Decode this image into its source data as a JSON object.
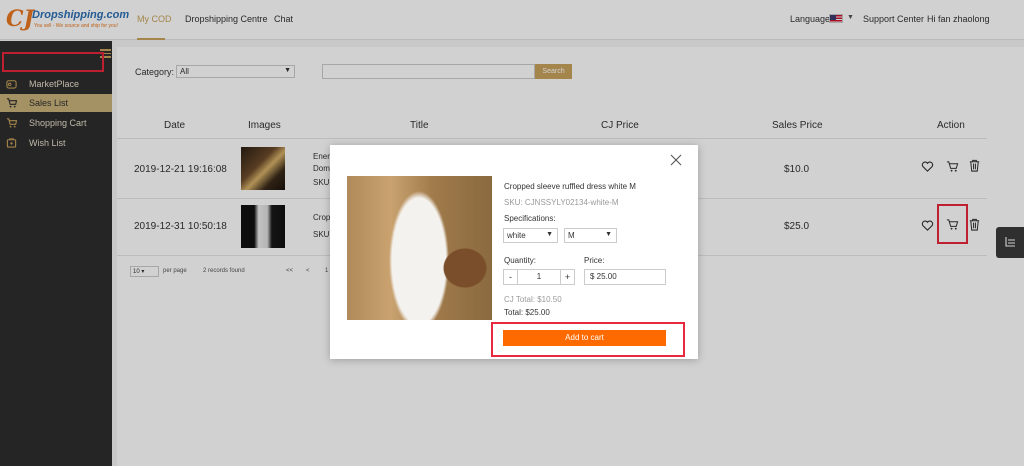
{
  "header": {
    "logo_mark": "CJ",
    "logo_text": "Dropshipping.com",
    "logo_tagline": "You sell - We source and ship for you!",
    "nav": [
      {
        "label": "My COD",
        "active": true
      },
      {
        "label": "Dropshipping Centre",
        "active": false
      },
      {
        "label": "Chat",
        "active": false
      }
    ],
    "language_label": "Language",
    "support_label": "Support Center",
    "greeting": "Hi fan zhaolong"
  },
  "sidebar": {
    "items": [
      {
        "label": "MarketPlace",
        "icon": "marketplace-icon"
      },
      {
        "label": "Sales List",
        "icon": "sales-cart-icon",
        "active": true
      },
      {
        "label": "Shopping Cart",
        "icon": "shopping-cart-icon"
      },
      {
        "label": "Wish List",
        "icon": "wish-list-icon"
      }
    ]
  },
  "filters": {
    "category_label": "Category:",
    "category_value": "All",
    "search_placeholder": "",
    "search_button": "Search"
  },
  "table": {
    "headers": [
      "Date",
      "Images",
      "Title",
      "CJ Price",
      "Sales Price",
      "Action"
    ],
    "rows": [
      {
        "date": "2019-12-21 19:16:08",
        "title_line1": "Ener",
        "title_line2": "Dom",
        "title_line3": "SKU",
        "sales_price": "$10.0"
      },
      {
        "date": "2019-12-31 10:50:18",
        "title_line1": "Crop",
        "title_line2": "SKU",
        "sales_price": "$25.0"
      }
    ]
  },
  "pagination": {
    "per_page_value": "10",
    "per_page_label": "per page",
    "records_text": "2 records found",
    "first": "<<",
    "prev": "<",
    "page": "1"
  },
  "modal": {
    "product_title": "Cropped sleeve ruffled dress white M",
    "sku": "SKU: CJNSSYLY02134-white-M",
    "specifications_label": "Specifications:",
    "color_value": "white",
    "size_value": "M",
    "quantity_label": "Quantity:",
    "quantity_value": "1",
    "minus": "-",
    "plus": "+",
    "price_label": "Price:",
    "price_value": "$ 25.00",
    "cj_total": "CJ Total:  $10.50",
    "total": "Total:  $25.00",
    "add_to_cart": "Add to cart"
  },
  "colors": {
    "accent_gold": "#c9a35c",
    "cta_orange": "#ff6a00",
    "highlight_red": "#e8283c",
    "sidebar_bg": "#2e2e2e"
  }
}
